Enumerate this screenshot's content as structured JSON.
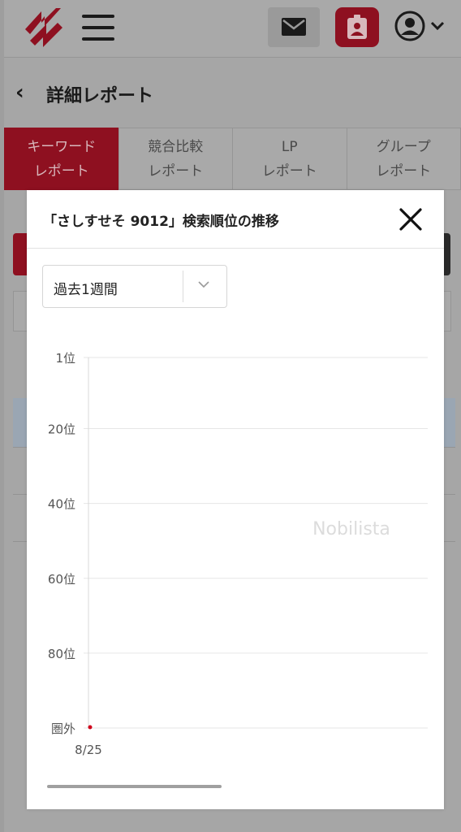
{
  "header": {
    "mail_icon": "mail-icon",
    "profile_card_icon": "id-card-icon",
    "user_icon": "user-circle-icon",
    "accent": "#8e1020"
  },
  "subheader": {
    "back_symbol": "‹",
    "title": "詳細レポート"
  },
  "tabs": [
    {
      "line1": "キーワード",
      "line2": "レポート",
      "active": true
    },
    {
      "line1": "競合比較",
      "line2": "レポート",
      "active": false
    },
    {
      "line1": "LP",
      "line2": "レポート",
      "active": false
    },
    {
      "line1": "グループ",
      "line2": "レポート",
      "active": false
    }
  ],
  "modal": {
    "title": "「さしすせそ 9012」検索順位の推移",
    "close_symbol": "✕",
    "period": {
      "selected": "過去1週間"
    }
  },
  "chart_data": {
    "type": "line",
    "title": "",
    "watermark": "Nobilista",
    "y_axis": {
      "reversed": true,
      "ticks": [
        {
          "value": 1,
          "label": "1位"
        },
        {
          "value": 20,
          "label": "20位"
        },
        {
          "value": 40,
          "label": "40位"
        },
        {
          "value": 60,
          "label": "60位"
        },
        {
          "value": 80,
          "label": "80位"
        },
        {
          "value": 100,
          "label": "圏外"
        }
      ],
      "range": [
        1,
        100
      ]
    },
    "x": [
      "8/25"
    ],
    "series": [
      {
        "values": [
          100
        ],
        "color": "#d0021b"
      }
    ],
    "grid": true
  }
}
